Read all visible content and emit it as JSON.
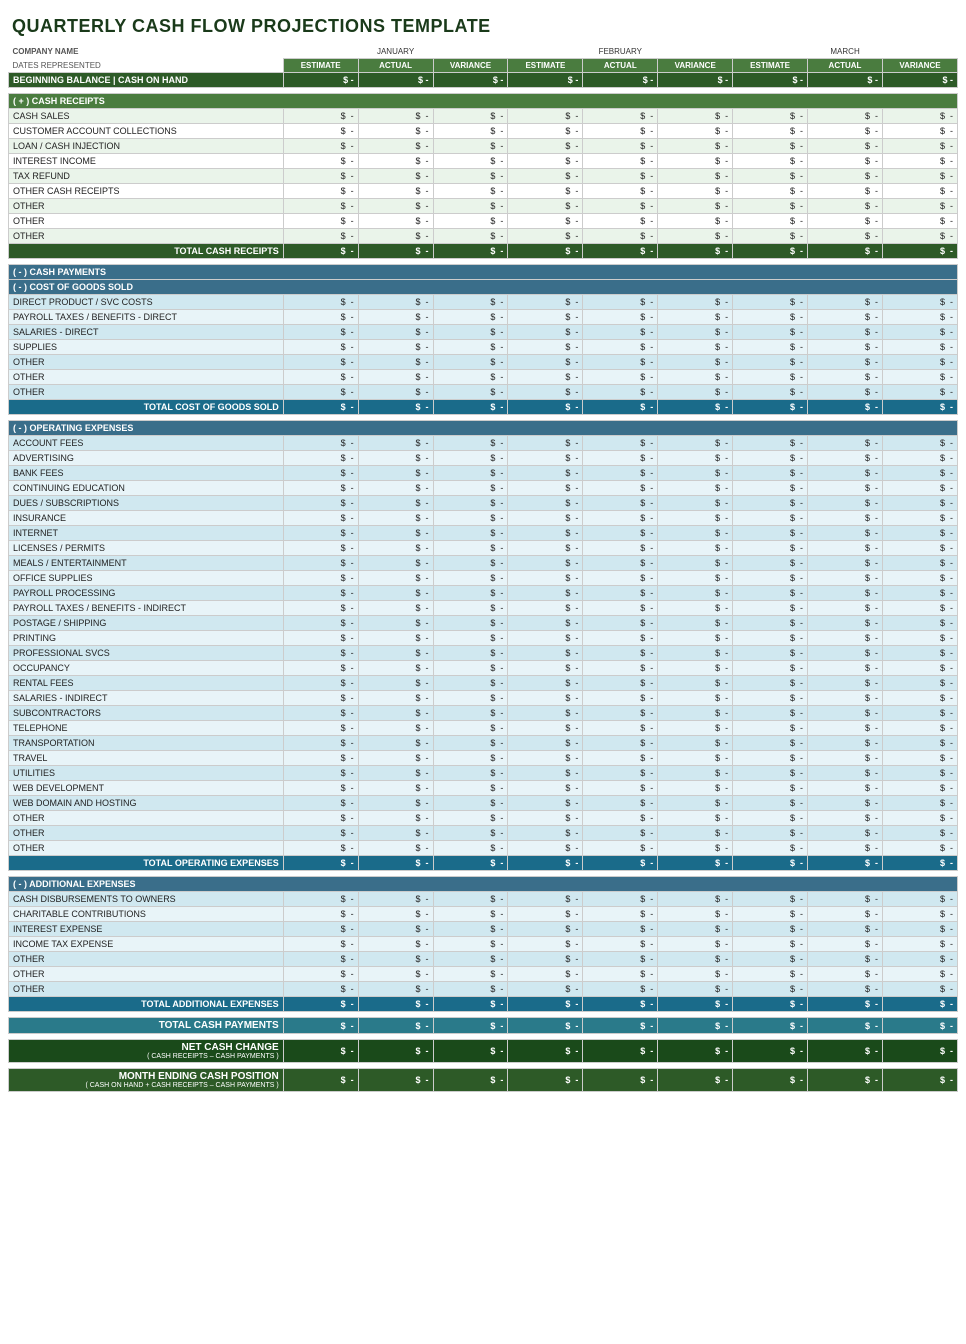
{
  "title": "QUARTERLY CASH FLOW PROJECTIONS TEMPLATE",
  "meta": {
    "company_label": "COMPANY NAME",
    "dates_label": "DATES REPRESENTED"
  },
  "months": [
    "JANUARY",
    "FEBRUARY",
    "MARCH"
  ],
  "col_headers": [
    "ESTIMATE",
    "ACTUAL",
    "VARIANCE"
  ],
  "dollar_sign": "$",
  "dash": "-",
  "sections": {
    "beginning_balance": "BEGINNING BALANCE | CASH ON HAND",
    "cash_receipts_header": "( + )  CASH RECEIPTS",
    "cash_receipts_items": [
      "CASH SALES",
      "CUSTOMER ACCOUNT COLLECTIONS",
      "LOAN / CASH INJECTION",
      "INTEREST INCOME",
      "TAX REFUND",
      "OTHER CASH RECEIPTS",
      "OTHER",
      "OTHER",
      "OTHER"
    ],
    "total_cash_receipts": "TOTAL CASH RECEIPTS",
    "cash_payments_header": "( - )  CASH PAYMENTS",
    "cogs_header": "( - )  COST OF GOODS SOLD",
    "cogs_items": [
      "DIRECT PRODUCT / SVC COSTS",
      "PAYROLL TAXES / BENEFITS - DIRECT",
      "SALARIES - DIRECT",
      "SUPPLIES",
      "OTHER",
      "OTHER",
      "OTHER"
    ],
    "total_cogs": "TOTAL COST OF GOODS SOLD",
    "operating_header": "( - )  OPERATING EXPENSES",
    "operating_items": [
      "ACCOUNT FEES",
      "ADVERTISING",
      "BANK FEES",
      "CONTINUING EDUCATION",
      "DUES / SUBSCRIPTIONS",
      "INSURANCE",
      "INTERNET",
      "LICENSES / PERMITS",
      "MEALS / ENTERTAINMENT",
      "OFFICE SUPPLIES",
      "PAYROLL PROCESSING",
      "PAYROLL TAXES / BENEFITS - INDIRECT",
      "POSTAGE / SHIPPING",
      "PRINTING",
      "PROFESSIONAL SVCS",
      "OCCUPANCY",
      "RENTAL FEES",
      "SALARIES - INDIRECT",
      "SUBCONTRACTORS",
      "TELEPHONE",
      "TRANSPORTATION",
      "TRAVEL",
      "UTILITIES",
      "WEB DEVELOPMENT",
      "WEB DOMAIN AND HOSTING",
      "OTHER",
      "OTHER",
      "OTHER"
    ],
    "total_operating": "TOTAL OPERATING EXPENSES",
    "additional_header": "( - )  ADDITIONAL EXPENSES",
    "additional_items": [
      "CASH DISBURSEMENTS TO OWNERS",
      "CHARITABLE CONTRIBUTIONS",
      "INTEREST EXPENSE",
      "INCOME TAX EXPENSE",
      "OTHER",
      "OTHER",
      "OTHER"
    ],
    "total_additional": "TOTAL ADDITIONAL EXPENSES",
    "total_cash_payments": "TOTAL CASH PAYMENTS",
    "net_cash_change": "NET CASH CHANGE",
    "net_cash_sub": "( CASH RECEIPTS – CASH PAYMENTS )",
    "month_ending": "MONTH ENDING CASH POSITION",
    "month_ending_sub": "( CASH ON HAND + CASH RECEIPTS – CASH PAYMENTS )"
  }
}
